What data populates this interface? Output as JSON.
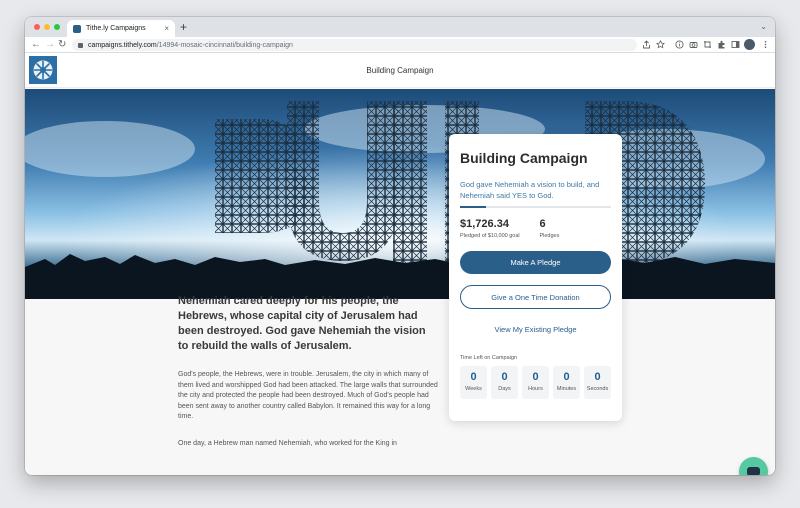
{
  "browser": {
    "tab_title": "Tithe.ly Campaigns",
    "tab_close": "×",
    "new_tab": "+",
    "tab_menu": "⌄",
    "nav_back": "←",
    "nav_forward": "→",
    "nav_reload": "↻",
    "url_host": "campaigns.tithely.com",
    "url_path": "/14994-mosaic-cincinnati/building-campaign",
    "toolbar_icons": [
      "share-icon",
      "star-icon",
      "info-icon",
      "camera-icon",
      "crop-icon",
      "extensions-icon",
      "sidebar-icon",
      "profile-avatar",
      "kebab-menu-icon"
    ]
  },
  "header": {
    "title": "Building Campaign"
  },
  "hero": {
    "letters": [
      "B",
      "U",
      "I",
      "L",
      "D"
    ]
  },
  "content": {
    "lead": "Nehemiah cared deeply for his people, the Hebrews, whose capital city of Jerusalem had been destroyed. God gave Nehemiah the vision to rebuild the walls of Jerusalem.",
    "paragraph1": "God's people, the Hebrews, were in trouble. Jerusalem, the city in which many of them lived and worshipped God had been attacked. The large walls that surrounded the city and protected the people had been destroyed. Much of God's people had been sent away to another country called Babylon. It remained this way for a long time.",
    "paragraph2": "One day, a Hebrew man named Nehemiah, who worked for the King in"
  },
  "card": {
    "title": "Building Campaign",
    "subtitle": "God gave Nehemiah a vision to build, and Nehemiah said YES to God.",
    "progress_fraction": 0.17,
    "pledged_value": "$1,726.34",
    "pledged_label": "Pledged of $10,000 goal",
    "pledges_value": "6",
    "pledges_label": "Pledges",
    "make_pledge": "Make A Pledge",
    "one_time": "Give a One Time Donation",
    "view_pledge": "View My Existing Pledge",
    "time_left_label": "Time Left on Campaign",
    "countdown": [
      {
        "value": "0",
        "unit": "Weeks"
      },
      {
        "value": "0",
        "unit": "Days"
      },
      {
        "value": "0",
        "unit": "Hours"
      },
      {
        "value": "0",
        "unit": "Minutes"
      },
      {
        "value": "0",
        "unit": "Seconds"
      }
    ]
  },
  "colors": {
    "accent": "#2a5f8a",
    "chat": "#55c9a0",
    "link_text": "#3f7aa8"
  }
}
